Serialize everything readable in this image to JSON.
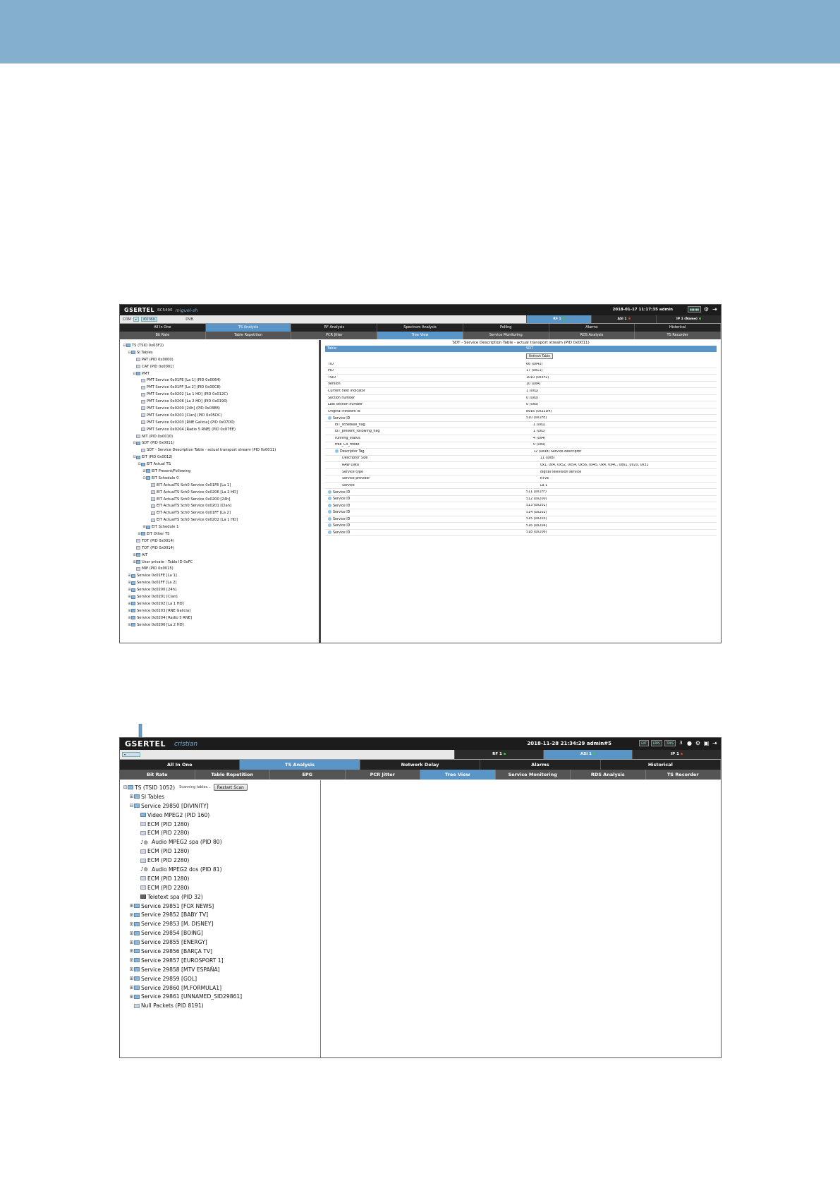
{
  "shot1": {
    "brand": "GSERTEL",
    "model": "RC5400",
    "user": "miguel-sh",
    "datetime": "2018-01-17 11:17:35 admin",
    "input_label": "COM",
    "freq": "402 MHz",
    "std": "DVB",
    "status": [
      {
        "label": "RF 1",
        "active": true,
        "dot": "green"
      },
      {
        "label": "ASI 1",
        "active": false,
        "dot": "red"
      },
      {
        "label": "IP 1 (Name)",
        "active": false,
        "dot": "green"
      }
    ],
    "main_tabs": [
      "All In One",
      "TS Analysis",
      "RF Analysis",
      "Spectrum Analysis",
      "Polling",
      "Alarms",
      "Historical"
    ],
    "main_active": 1,
    "sub_tabs": [
      "Bit Rate",
      "Table Repetition",
      "PCR Jitter",
      "Tree View",
      "Service Monitoring",
      "RDS Analysis",
      "TS Recorder"
    ],
    "sub_active": 3,
    "tree": [
      {
        "lvl": 0,
        "pm": "-",
        "icon": "folder",
        "text": "TS (TSID 0x03F2)"
      },
      {
        "lvl": 1,
        "pm": "-",
        "icon": "folder",
        "text": "SI Tables"
      },
      {
        "lvl": 2,
        "pm": "",
        "icon": "file",
        "text": "PAT (PID 0x0000)"
      },
      {
        "lvl": 2,
        "pm": "",
        "icon": "file",
        "text": "CAT (PID 0x0001)"
      },
      {
        "lvl": 2,
        "pm": "-",
        "icon": "folder",
        "text": "PMT"
      },
      {
        "lvl": 3,
        "pm": "",
        "icon": "file",
        "text": "PMT Service 0x01FE [La 1] (PID 0x0064)"
      },
      {
        "lvl": 3,
        "pm": "",
        "icon": "file",
        "text": "PMT Service 0x01FF [La 2] (PID 0x00C8)"
      },
      {
        "lvl": 3,
        "pm": "",
        "icon": "file",
        "text": "PMT Service 0x0202 [La 1 HD] (PID 0x012C)"
      },
      {
        "lvl": 3,
        "pm": "",
        "icon": "file",
        "text": "PMT Service 0x0206 [La 2 HD] (PID 0x0190)"
      },
      {
        "lvl": 3,
        "pm": "",
        "icon": "file",
        "text": "PMT Service 0x0200 [24h] (PID 0x03E8)"
      },
      {
        "lvl": 3,
        "pm": "",
        "icon": "file",
        "text": "PMT Service 0x0201 [Clan] (PID 0x05DC)"
      },
      {
        "lvl": 3,
        "pm": "",
        "icon": "file",
        "text": "PMT Service 0x0203 [RNE Galicia] (PID 0x07D0)"
      },
      {
        "lvl": 3,
        "pm": "",
        "icon": "file",
        "text": "PMT Service 0x0204 [Radio 5 RNE] (PID 0x07EE)"
      },
      {
        "lvl": 2,
        "pm": "",
        "icon": "file",
        "text": "NIT (PID 0x0010)"
      },
      {
        "lvl": 2,
        "pm": "-",
        "icon": "folder",
        "text": "SDT (PID 0x0011)"
      },
      {
        "lvl": 3,
        "pm": "",
        "icon": "file",
        "text": "SDT - Service Description Table - actual transport stream (PID 0x0011)"
      },
      {
        "lvl": 2,
        "pm": "-",
        "icon": "folder",
        "text": "EIT (PID 0x0012)"
      },
      {
        "lvl": 3,
        "pm": "-",
        "icon": "folder",
        "text": "EIT Actual TS"
      },
      {
        "lvl": 4,
        "pm": "+",
        "icon": "folder",
        "text": "EIT Present/Following"
      },
      {
        "lvl": 4,
        "pm": "-",
        "icon": "folder",
        "text": "EIT Schedule 0"
      },
      {
        "lvl": 5,
        "pm": "",
        "icon": "file",
        "text": "EIT ActualTS Sch0 Service 0x01FE [La 1]"
      },
      {
        "lvl": 5,
        "pm": "",
        "icon": "file",
        "text": "EIT ActualTS Sch0 Service 0x0206 [La 2 HD]"
      },
      {
        "lvl": 5,
        "pm": "",
        "icon": "file",
        "text": "EIT ActualTS Sch0 Service 0x0200 [24h]"
      },
      {
        "lvl": 5,
        "pm": "",
        "icon": "file",
        "text": "EIT ActualTS Sch0 Service 0x0201 [Clan]"
      },
      {
        "lvl": 5,
        "pm": "",
        "icon": "file",
        "text": "EIT ActualTS Sch0 Service 0x01FF [La 2]"
      },
      {
        "lvl": 5,
        "pm": "",
        "icon": "file",
        "text": "EIT ActualTS Sch0 Service 0x0202 [La 1 HD]"
      },
      {
        "lvl": 4,
        "pm": "+",
        "icon": "folder",
        "text": "EIT Schedule 1"
      },
      {
        "lvl": 3,
        "pm": "+",
        "icon": "folder",
        "text": "EIT Other TS"
      },
      {
        "lvl": 2,
        "pm": "",
        "icon": "file",
        "text": "TDT (PID 0x0014)"
      },
      {
        "lvl": 2,
        "pm": "",
        "icon": "file",
        "text": "TOT (PID 0x0014)"
      },
      {
        "lvl": 2,
        "pm": "+",
        "icon": "folder",
        "text": "AIT"
      },
      {
        "lvl": 2,
        "pm": "+",
        "icon": "folder",
        "text": "User private - Table ID 0xFC"
      },
      {
        "lvl": 2,
        "pm": "",
        "icon": "file",
        "text": "MIP (PID 0x0015)"
      },
      {
        "lvl": 1,
        "pm": "+",
        "icon": "folder",
        "text": "Service 0x01FE [La 1]"
      },
      {
        "lvl": 1,
        "pm": "+",
        "icon": "folder",
        "text": "Service 0x01FF [La 2]"
      },
      {
        "lvl": 1,
        "pm": "+",
        "icon": "folder",
        "text": "Service 0x0200 [24h]"
      },
      {
        "lvl": 1,
        "pm": "+",
        "icon": "folder",
        "text": "Service 0x0201 [Clan]"
      },
      {
        "lvl": 1,
        "pm": "+",
        "icon": "folder",
        "text": "Service 0x0202 [La 1 HD]"
      },
      {
        "lvl": 1,
        "pm": "+",
        "icon": "folder",
        "text": "Service 0x0203 [RNE Galicia]"
      },
      {
        "lvl": 1,
        "pm": "+",
        "icon": "folder",
        "text": "Service 0x0204 [Radio 5 RNE]"
      },
      {
        "lvl": 1,
        "pm": "+",
        "icon": "folder",
        "text": "Service 0x0206 [La 2 HD]"
      }
    ],
    "detail_title": "SDT - Service Description Table - actual transport stream (PID 0x0011)",
    "table_header": {
      "k": "Table",
      "v": "SDT"
    },
    "refresh_label": "Refresh Table",
    "rows": [
      {
        "ind": 0,
        "b": false,
        "k": "TID",
        "v": "66 (0x42)"
      },
      {
        "ind": 0,
        "b": false,
        "k": "PID",
        "v": "17 (0x11)"
      },
      {
        "ind": 0,
        "b": false,
        "k": "TSID",
        "v": "1010 (0x3F2)"
      },
      {
        "ind": 0,
        "b": false,
        "k": "Version",
        "v": "10 (0xA)"
      },
      {
        "ind": 0,
        "b": false,
        "k": "Current next indicator",
        "v": "1 (0x1)"
      },
      {
        "ind": 0,
        "b": false,
        "k": "Section number",
        "v": "0 (0x0)"
      },
      {
        "ind": 0,
        "b": false,
        "k": "Last section number",
        "v": "0 (0x0)"
      },
      {
        "ind": 0,
        "b": false,
        "k": "Original network id",
        "v": "8916 (0x22D4)"
      },
      {
        "ind": 0,
        "b": true,
        "k": "Service ID",
        "v": "510 (0x1FE)"
      },
      {
        "ind": 1,
        "b": false,
        "k": "EIT_schedule_flag",
        "v": "1 (0x1)"
      },
      {
        "ind": 1,
        "b": false,
        "k": "EIT_present_following_flag",
        "v": "1 (0x1)"
      },
      {
        "ind": 1,
        "b": false,
        "k": "running_status",
        "v": "4 (0x4)"
      },
      {
        "ind": 1,
        "b": false,
        "k": "free_CA_mode",
        "v": "0 (0x0)"
      },
      {
        "ind": 1,
        "b": true,
        "k": "Descriptor Tag",
        "v": "72 (0x48) Service descriptor"
      },
      {
        "ind": 2,
        "b": false,
        "k": "Descriptor Size",
        "v": "11 (0xB)"
      },
      {
        "ind": 2,
        "b": false,
        "k": "RAW Data",
        "v": "0x1, 0x4, 0x52, 0x54, 0x56, 0x45, 0x4, 0x4C, 0x61, 0x20, 0x31"
      },
      {
        "ind": 2,
        "b": false,
        "k": "Service type",
        "v": "digital television service"
      },
      {
        "ind": 2,
        "b": false,
        "k": "Service provider",
        "v": "RTVE"
      },
      {
        "ind": 2,
        "b": false,
        "k": "Service",
        "v": "La 1"
      },
      {
        "ind": 0,
        "b": true,
        "k": "Service ID",
        "v": "511 (0x1FF)"
      },
      {
        "ind": 0,
        "b": true,
        "k": "Service ID",
        "v": "512 (0x200)"
      },
      {
        "ind": 0,
        "b": true,
        "k": "Service ID",
        "v": "513 (0x201)"
      },
      {
        "ind": 0,
        "b": true,
        "k": "Service ID",
        "v": "514 (0x202)"
      },
      {
        "ind": 0,
        "b": true,
        "k": "Service ID",
        "v": "515 (0x203)"
      },
      {
        "ind": 0,
        "b": true,
        "k": "Service ID",
        "v": "516 (0x204)"
      },
      {
        "ind": 0,
        "b": true,
        "k": "Service ID",
        "v": "518 (0x206)"
      }
    ]
  },
  "shot2": {
    "brand": "GSERTEL",
    "user": "cristian",
    "datetime": "2018-11-28 21:34:29 admin#5",
    "mini_boxes": [
      "EXT",
      "EPPS",
      "TRPS"
    ],
    "user_count": "3",
    "status": [
      {
        "label": "RF 1",
        "active": false,
        "dot": "green"
      },
      {
        "label": "ASI 1",
        "active": true,
        "dot": "green"
      },
      {
        "label": "IP 1",
        "active": false,
        "dot": "red"
      }
    ],
    "main_tabs": [
      "All In One",
      "TS Analysis",
      "Network Delay",
      "Alarms",
      "Historical"
    ],
    "main_active": 1,
    "sub_tabs": [
      "Bit Rate",
      "Table Repetition",
      "EPG",
      "PCR Jitter",
      "Tree View",
      "Service Monitoring",
      "RDS Analysis",
      "TS Recorder"
    ],
    "sub_active": 4,
    "scan_label": "Scanning tables...",
    "restart_label": "Restart Scan",
    "tree": [
      {
        "lvl": 0,
        "pm": "-",
        "icon": "folder",
        "text": "TS (TSID 1052)"
      },
      {
        "lvl": 1,
        "pm": "+",
        "icon": "folder",
        "text": "SI Tables"
      },
      {
        "lvl": 1,
        "pm": "-",
        "icon": "folder",
        "text": "Service 29850 [DIVINITY]"
      },
      {
        "lvl": 2,
        "pm": "",
        "icon": "video",
        "text": "Video MPEG2 (PID 160)"
      },
      {
        "lvl": 2,
        "pm": "",
        "icon": "file",
        "text": "ECM (PID 1280)"
      },
      {
        "lvl": 2,
        "pm": "",
        "icon": "file",
        "text": "ECM (PID 2280)"
      },
      {
        "lvl": 2,
        "pm": "",
        "icon": "audio",
        "text": "Audio MPEG2 spa (PID 80)"
      },
      {
        "lvl": 2,
        "pm": "",
        "icon": "file",
        "text": "ECM (PID 1280)"
      },
      {
        "lvl": 2,
        "pm": "",
        "icon": "file",
        "text": "ECM (PID 2280)"
      },
      {
        "lvl": 2,
        "pm": "",
        "icon": "audio",
        "text": "Audio MPEG2 dos (PID 81)"
      },
      {
        "lvl": 2,
        "pm": "",
        "icon": "file",
        "text": "ECM (PID 1280)"
      },
      {
        "lvl": 2,
        "pm": "",
        "icon": "file",
        "text": "ECM (PID 2280)"
      },
      {
        "lvl": 2,
        "pm": "",
        "icon": "tele",
        "text": "Teletext spa (PID 32)"
      },
      {
        "lvl": 1,
        "pm": "+",
        "icon": "folder",
        "text": "Service 29851 [FOX NEWS]"
      },
      {
        "lvl": 1,
        "pm": "+",
        "icon": "folder",
        "text": "Service 29852 [BABY TV]"
      },
      {
        "lvl": 1,
        "pm": "+",
        "icon": "folder",
        "text": "Service 29853 [M. DISNEY]"
      },
      {
        "lvl": 1,
        "pm": "+",
        "icon": "folder",
        "text": "Service 29854 [BOING]"
      },
      {
        "lvl": 1,
        "pm": "+",
        "icon": "folder",
        "text": "Service 29855 [ENERGY]"
      },
      {
        "lvl": 1,
        "pm": "+",
        "icon": "folder",
        "text": "Service 29856 [BARÇA TV]"
      },
      {
        "lvl": 1,
        "pm": "+",
        "icon": "folder",
        "text": "Service 29857 [EUROSPORT 1]"
      },
      {
        "lvl": 1,
        "pm": "+",
        "icon": "folder",
        "text": "Service 29858 [MTV ESPAÑA]"
      },
      {
        "lvl": 1,
        "pm": "+",
        "icon": "folder",
        "text": "Service 29859 [GOL]"
      },
      {
        "lvl": 1,
        "pm": "+",
        "icon": "folder",
        "text": "Service 29860 [M.FORMULA1]"
      },
      {
        "lvl": 1,
        "pm": "+",
        "icon": "folder",
        "text": "Service 29861 [UNNAMED_SID29861]"
      },
      {
        "lvl": 1,
        "pm": "",
        "icon": "file",
        "text": "Null Packets (PID 8191)"
      }
    ]
  }
}
